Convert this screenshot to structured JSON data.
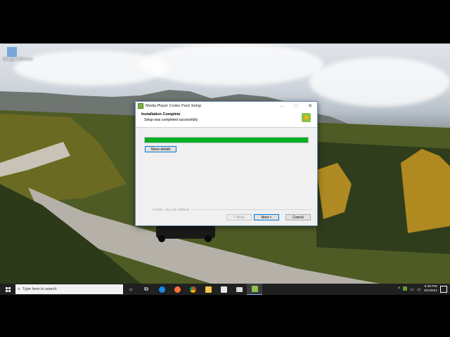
{
  "desktop": {
    "icon_label": "Google Chrome"
  },
  "dialog": {
    "title": "Media Player Codec Pack Setup",
    "controls": {
      "minimize": "—",
      "maximize": "☐",
      "close": "✕"
    },
    "heading": "Installation Complete",
    "subheading": "Setup was completed successfully",
    "progress_percent": 100,
    "progress_color": "#06b025",
    "show_details_label": "Show details",
    "copyright": "© 2021 - By Cole Williams",
    "back_label": "< Back",
    "next_label": "Next >",
    "cancel_label": "Cancel"
  },
  "taskbar": {
    "search_placeholder": "Type here to search",
    "search_icon": "search-icon",
    "icons": [
      "cortana-icon",
      "task-view-icon",
      "edge-icon",
      "firefox-icon",
      "chrome-icon",
      "file-explorer-icon",
      "store-icon",
      "mail-icon",
      "codec-setup-icon"
    ],
    "tray": {
      "chevron": "^",
      "clock_time": "8:46 PM",
      "clock_date": "6/1/2021"
    }
  }
}
